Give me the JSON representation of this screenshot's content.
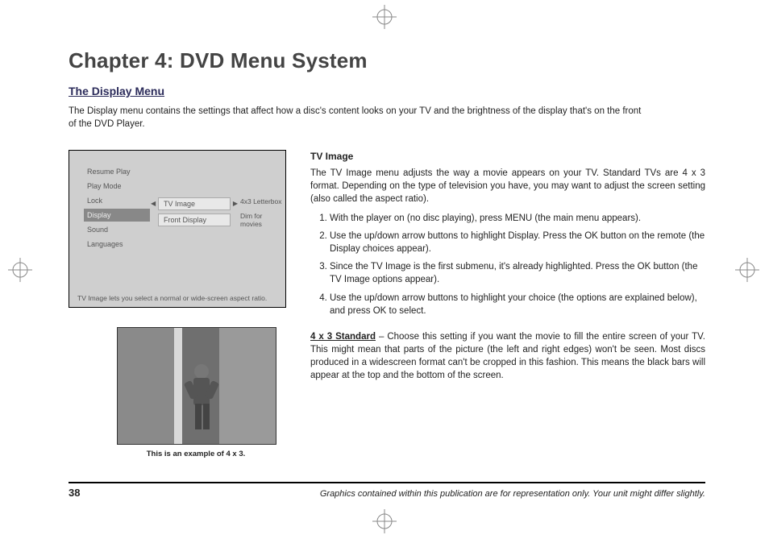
{
  "chapter_title": "Chapter 4: DVD Menu System",
  "section_title": "The Display Menu",
  "intro": "The Display menu contains the settings that affect how a disc's content looks on your TV and the brightness of the display that's on the front of the DVD Player.",
  "menu_screenshot": {
    "left_items": [
      "Resume Play",
      "Play Mode",
      "Lock",
      "Display",
      "Sound",
      "Languages"
    ],
    "selected_left": "Display",
    "mid_items": [
      "TV Image",
      "Front Display"
    ],
    "right_items": [
      "4x3 Letterbox",
      "Dim for movies"
    ],
    "caption": "TV Image lets you select a normal or wide-screen aspect ratio."
  },
  "photo_caption": "This is an example of 4 x 3.",
  "right": {
    "sub_title": "TV Image",
    "para1": "The TV Image menu adjusts the way a movie appears on your TV. Standard TVs are 4 x 3 format. Depending on the type of television you have, you may want to adjust the screen setting (also called the aspect ratio).",
    "steps": [
      "With the player on (no disc playing), press MENU (the main menu appears).",
      "Use the up/down arrow buttons to highlight Display. Press the OK button on the remote (the Display choices appear).",
      "Since the TV Image is the first submenu, it's already highlighted. Press the OK button (the TV Image options appear).",
      "Use the up/down arrow buttons to highlight your choice (the options are explained below), and press OK to select."
    ],
    "standard_label": "4 x 3 Standard",
    "standard_text": " – Choose this setting if you want the movie to fill the entire screen of your TV. This might mean that parts of the picture (the left and right edges) won't be seen. Most discs produced in a widescreen format can't be cropped in this fashion. This means the black bars will appear at the top and the bottom of the screen."
  },
  "footer": {
    "page": "38",
    "note": "Graphics contained within this publication are for representation only. Your unit might differ slightly."
  }
}
